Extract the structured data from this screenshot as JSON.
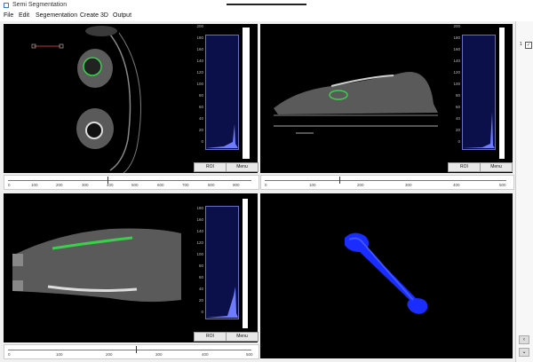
{
  "window": {
    "title": "Semi Segmentation"
  },
  "menu": [
    "File",
    "Edit",
    "Segementation",
    "Create 3D",
    "Output"
  ],
  "views": {
    "axial": {
      "hist_ticks": [
        "200",
        "180",
        "160",
        "140",
        "120",
        "100",
        "80",
        "60",
        "40",
        "20",
        "0"
      ],
      "roi_label": "ROI",
      "menu_label": "Menu",
      "scale_ticks": [
        "0",
        "100",
        "200",
        "300",
        "400",
        "500",
        "600",
        "700",
        "800",
        "900"
      ]
    },
    "sagittal": {
      "hist_ticks": [
        "200",
        "180",
        "160",
        "140",
        "120",
        "100",
        "80",
        "60",
        "40",
        "20",
        "0"
      ],
      "roi_label": "ROI",
      "menu_label": "Menu",
      "scale_ticks": [
        "0",
        "100",
        "200",
        "300",
        "400",
        "500"
      ]
    },
    "coronal": {
      "hist_ticks": [
        "180",
        "160",
        "140",
        "120",
        "100",
        "80",
        "60",
        "40",
        "20",
        "0"
      ],
      "roi_label": "ROI",
      "menu_label": "Menu",
      "scale_ticks": [
        "0",
        "100",
        "200",
        "300",
        "400",
        "500"
      ]
    }
  },
  "right_panel": {
    "item_label": "1"
  },
  "colors": {
    "segmentation": "#39d04a",
    "render_3d": "#1a2cff",
    "histogram_bg": "#0b0f4a"
  }
}
